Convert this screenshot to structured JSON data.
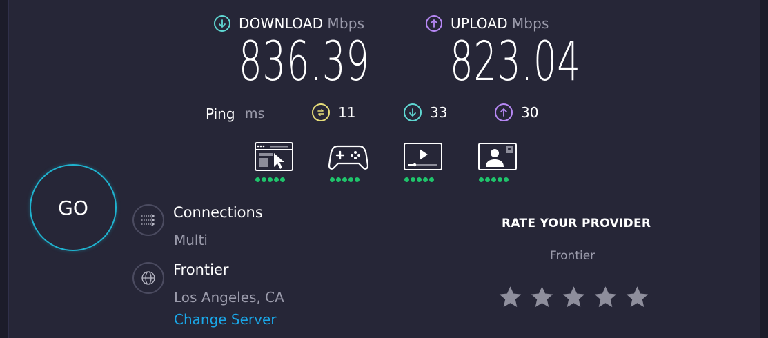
{
  "download": {
    "title": "DOWNLOAD",
    "unit": "Mbps",
    "value": "836.39",
    "icon": "download-arrow-icon",
    "color": "#5fd8d3"
  },
  "upload": {
    "title": "UPLOAD",
    "unit": "Mbps",
    "value": "823.04",
    "icon": "upload-arrow-icon",
    "color": "#b788f5"
  },
  "ping": {
    "label": "Ping",
    "unit": "ms",
    "idle": {
      "value": "11",
      "icon": "ping-idle-icon",
      "color": "#e6dd7a"
    },
    "download": {
      "value": "33",
      "icon": "download-arrow-icon",
      "color": "#5fd8d3"
    },
    "upload": {
      "value": "30",
      "icon": "upload-arrow-icon",
      "color": "#b788f5"
    }
  },
  "experience_ratings": [
    {
      "name": "web-browsing-icon",
      "rating": 5,
      "max": 5
    },
    {
      "name": "gaming-icon",
      "rating": 5,
      "max": 5
    },
    {
      "name": "video-streaming-icon",
      "rating": 5,
      "max": 5
    },
    {
      "name": "video-chat-icon",
      "rating": 5,
      "max": 5
    }
  ],
  "go": {
    "label": "GO"
  },
  "connections": {
    "title": "Connections",
    "value": "Multi",
    "icon": "connections-icon"
  },
  "server": {
    "provider": "Frontier",
    "location": "Los Angeles, CA",
    "change_label": "Change Server",
    "icon": "globe-icon"
  },
  "rate": {
    "title": "RATE YOUR PROVIDER",
    "provider": "Frontier",
    "stars": 5
  },
  "colors": {
    "background": "#262637",
    "accent_go": "#1fb3cf",
    "link": "#1aa7e8",
    "dot": "#1fc46b",
    "star": "#8e8e9c"
  }
}
